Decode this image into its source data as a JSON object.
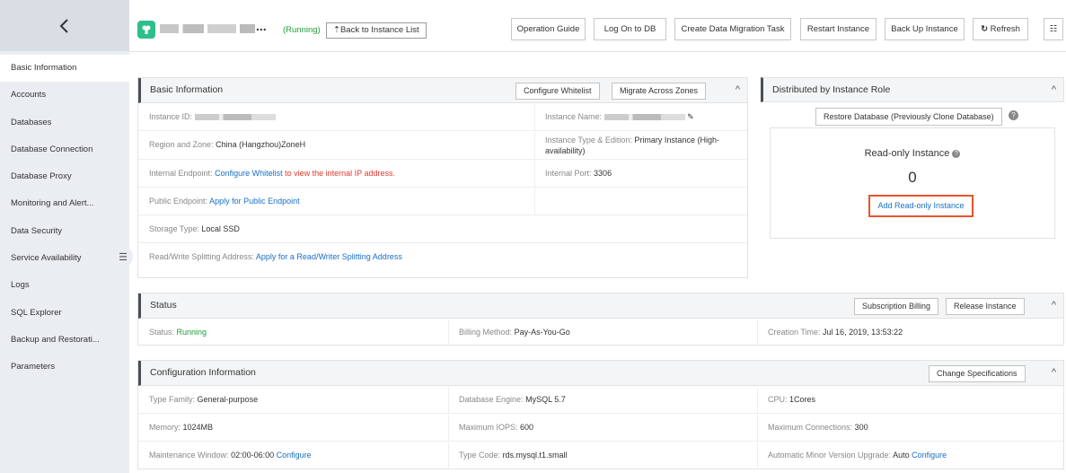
{
  "sidebar": {
    "back_icon": "chevron-left-icon",
    "items": [
      {
        "label": "Basic Information"
      },
      {
        "label": "Accounts"
      },
      {
        "label": "Databases"
      },
      {
        "label": "Database Connection"
      },
      {
        "label": "Database Proxy"
      },
      {
        "label": "Monitoring and Alert..."
      },
      {
        "label": "Data Security"
      },
      {
        "label": "Service Availability"
      },
      {
        "label": "Logs"
      },
      {
        "label": "SQL Explorer"
      },
      {
        "label": "Backup and Restorati..."
      },
      {
        "label": "Parameters"
      }
    ]
  },
  "header": {
    "ellipsis": "...",
    "status": "(Running)",
    "back_link": "⇡Back to Instance List",
    "buttons": {
      "operation_guide": "Operation Guide",
      "log_on": "Log On to DB",
      "migration": "Create Data Migration Task",
      "restart": "Restart Instance",
      "backup": "Back Up Instance",
      "refresh": "Refresh",
      "refresh_icon": "↻",
      "list_icon": "☷"
    }
  },
  "basic": {
    "title": "Basic Information",
    "configure_whitelist": "Configure Whitelist",
    "migrate_zones": "Migrate Across Zones",
    "instance_id_label": "Instance ID:",
    "instance_name_label": "Instance Name:",
    "region_label": "Region and Zone:",
    "region_value": "China (Hangzhou)ZoneH",
    "type_label": "Instance Type & Edition:",
    "type_value": "Primary Instance (High-",
    "type_value2": "availability)",
    "internal_label": "Internal Endpoint:",
    "internal_link": "Configure Whitelist",
    "internal_rest": "to view the internal IP address.",
    "port_label": "Internal Port:",
    "port_value": "3306",
    "public_label": "Public Endpoint:",
    "public_link": "Apply for Public Endpoint",
    "storage_label": "Storage Type:",
    "storage_value": "Local SSD",
    "rw_label": "Read/Write Splitting Address:",
    "rw_link": "Apply for a Read/Writer Splitting Address"
  },
  "distributed": {
    "title": "Distributed by Instance Role",
    "restore_button": "Restore Database (Previously Clone Database)",
    "readonly_label": "Read-only Instance",
    "readonly_count": "0",
    "add_readonly": "Add Read-only Instance",
    "highlight_color": "#e8542e"
  },
  "status": {
    "title": "Status",
    "subscription": "Subscription Billing",
    "release": "Release Instance",
    "status_label": "Status:",
    "status_value": "Running",
    "billing_label": "Billing Method:",
    "billing_value": "Pay-As-You-Go",
    "created_label": "Creation Time:",
    "created_value": "Jul 16, 2019, 13:53:22"
  },
  "config": {
    "title": "Configuration Information",
    "change_spec": "Change Specifications",
    "type_family_label": "Type Family:",
    "type_family_value": "General-purpose",
    "engine_label": "Database Engine:",
    "engine_value": "MySQL 5.7",
    "cpu_label": "CPU:",
    "cpu_value": "1Cores",
    "memory_label": "Memory:",
    "memory_value": "1024MB",
    "iops_label": "Maximum IOPS:",
    "iops_value": "600",
    "conn_label": "Maximum Connections:",
    "conn_value": "300",
    "maint_label": "Maintenance Window:",
    "maint_value": "02:00-06:00",
    "maint_link": "Configure",
    "typecode_label": "Type Code:",
    "typecode_value": "rds.mysql.t1.small",
    "minor_label": "Automatic Minor Version Upgrade:",
    "minor_value": "Auto",
    "minor_link": "Configure"
  },
  "collapse_icon": "^"
}
